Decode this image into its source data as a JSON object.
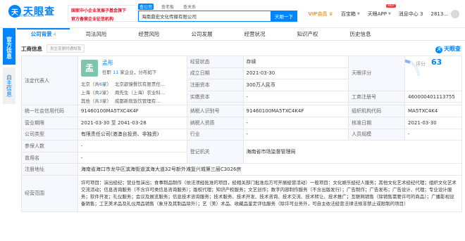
{
  "header": {
    "logo_mark": "天",
    "logo_text": "天眼查",
    "logo_sub": "TianYanCha.com",
    "promo_line1": "国家中小企业发展子基金旗下",
    "promo_line2": "官方备案企业征信机构",
    "search_tabs": [
      "查公司",
      "查老板",
      "查关系"
    ],
    "search_value": "海南鼎宏文化传媒有限公司",
    "search_button": "天眼一下",
    "vip_label": "VIP会员",
    "baidu_label": "百宝箱",
    "hot_badge": "HOT",
    "app_label": "天眼APP",
    "message_label": "消息中心",
    "message_count": "3",
    "user_label": "2813..."
  },
  "side": {
    "official_label": "官方信息",
    "self_label": "自主信息"
  },
  "tabs": [
    {
      "label": "公司背景",
      "count": "4"
    },
    {
      "label": "司法风险",
      "count": ""
    },
    {
      "label": "经营风险",
      "count": ""
    },
    {
      "label": "公司发展",
      "count": ""
    },
    {
      "label": "经营状况",
      "count": ""
    },
    {
      "label": "知识产权",
      "count": ""
    },
    {
      "label": "历史信息",
      "count": ""
    },
    {
      "label": "",
      "count": ""
    }
  ],
  "section": {
    "title": "工商信息",
    "tag": "发生变更时通知我",
    "brand": "天眼查"
  },
  "rep": {
    "label": "法定代表人",
    "avatar": "孟",
    "name": "孟彤",
    "sub_prefix": "任职",
    "sub_count": "11",
    "sub_suffix": "家企业，分布如下",
    "rows": [
      {
        "region": "北京（共",
        "n": "6",
        "tail": "家）",
        "company": "北京歆憶餐饮有限责任..."
      },
      {
        "region": "上海（共",
        "n": "2",
        "tail": "家）",
        "company": "周先生（上海）农业科..."
      },
      {
        "region": "其他（共",
        "n": "3",
        "tail": "家）",
        "company": "成都新就饭饮管理有..."
      }
    ]
  },
  "fields": {
    "status_label": "经营状态",
    "status": "存续",
    "founded_label": "成立日期",
    "founded": "2021-03-30",
    "capital_label": "注册资本",
    "capital": "300万人民币",
    "paid_label": "实缴资本",
    "paid": "-",
    "score_label": "天眼评分",
    "score_text": "评分",
    "score_value": "63",
    "reg_no_label": "工商注册号",
    "reg_no": "460000401113755",
    "credit_label": "统一社会信用代码",
    "credit": "91460100MA5TXC4K4F",
    "tax_label": "纳税人识别号",
    "tax": "91460100MA5TXC4K4F",
    "org_label": "组织机构代码",
    "org": "MA5TXC4K4",
    "term_label": "营业期限",
    "term": "2021-03-30 至 2041-03-28",
    "taxpayer_label": "纳税人资质",
    "taxpayer": "-",
    "approve_label": "核准日期",
    "approve": "2021-03-30",
    "type_label": "公司类型",
    "type": "有限责任公司(港澳台投资、非独资)",
    "industry_label": "行业",
    "industry": "-",
    "staff_label": "人员规模",
    "staff": "-",
    "insured_label": "参保人数",
    "insured": "-",
    "authority_label": "登记机关",
    "authority": "海南省市场监督管理局",
    "former_label": "曾用名",
    "former": "-",
    "address_label": "注册地址",
    "address": "海南省海口市龙华区滨海街道滨海大道32号新外滩复兴城第三层C3026房",
    "scope_label": "经营范围",
    "scope": "许可项目：演出经纪；营业性演出；食事制品制作（依法须经批准的项目，经相关部门批准后方可开展经营活动）一般项目：文化娱乐经纪人服务；其他文化艺术经纪代理；组织文化艺术交流活动；信息咨询服务（不含许可类信息咨询服务）；版权代理；知识产权服务；文艺创作；数字内容制作服务（不含出版发行）；广告制作；广告发布；广告设计、代理；专业设计服务；软件开发；礼仪服务；会议及展览服务；信息技术咨询服务；技术服务、技术开发、技术咨询、技术交流、技术转让、技术推广；互联网销售（除销售需要许可的商品）；广播影视设备销售；工艺美术品及礼仪用品销售（象牙及其制品除外）；艺（美）术品、收藏品鉴定评估服务（除许可业务外，可自主依法经营法律法规非禁止或限制的项目）"
  }
}
